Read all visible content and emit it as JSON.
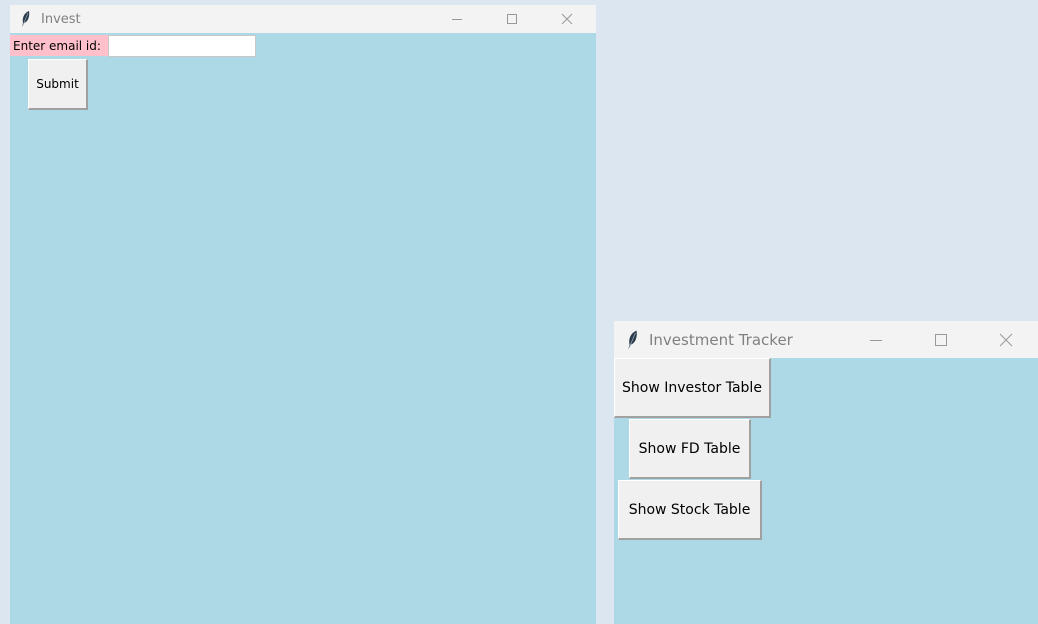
{
  "windows": [
    {
      "title": "Invest",
      "icon": "feather-icon",
      "controls": [
        "minimize-icon",
        "maximize-icon",
        "close-icon"
      ],
      "background": "#add8e6",
      "email_label": "Enter email id:",
      "email_value": "",
      "submit_label": "Submit"
    },
    {
      "title": "Investment Tracker",
      "icon": "feather-icon",
      "controls": [
        "minimize-icon",
        "maximize-icon",
        "close-icon"
      ],
      "background": "#add8e6",
      "buttons": [
        "Show Investor Table",
        "Show FD Table",
        "Show Stock Table"
      ]
    }
  ],
  "colors": {
    "desktop": "#dce6f0",
    "window_body": "#add8e6",
    "label_bg": "#ffc0cb",
    "titlebar": "#f3f3f3"
  }
}
